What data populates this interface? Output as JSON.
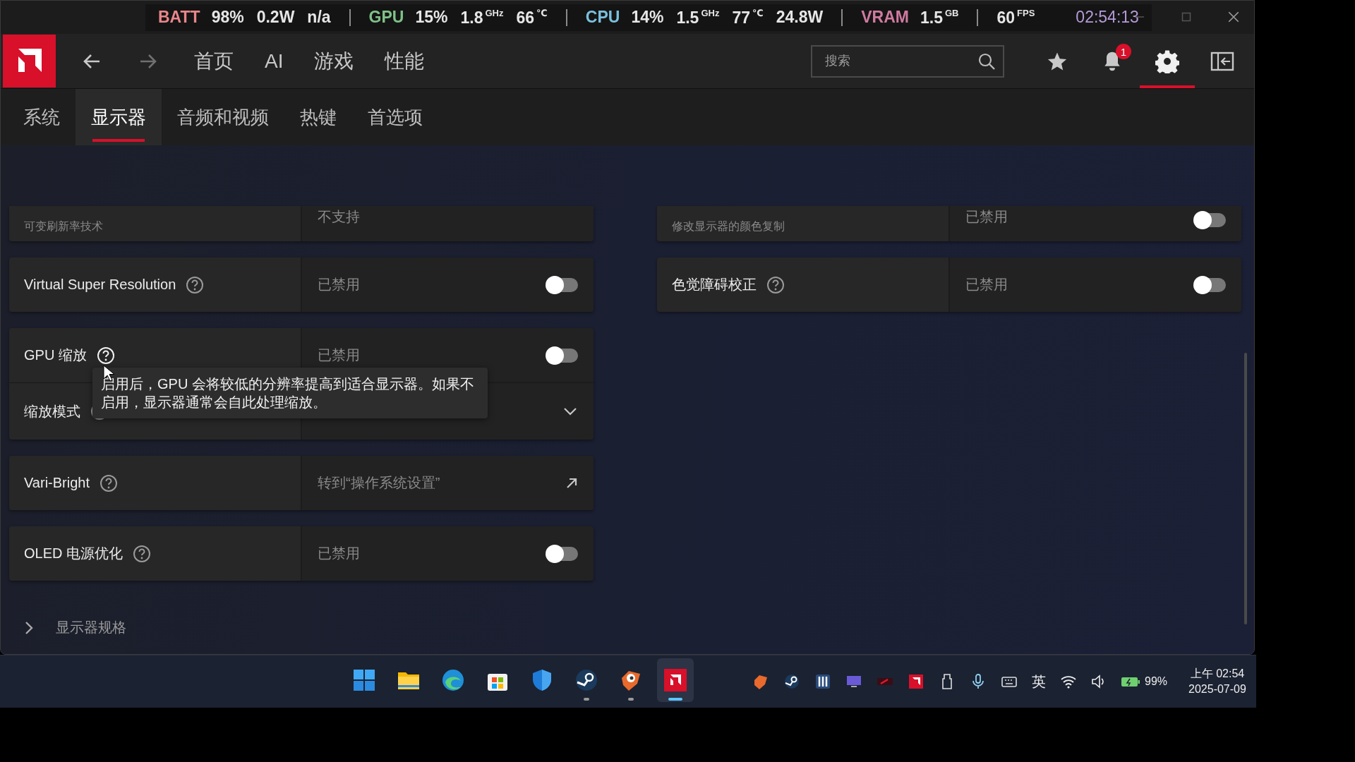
{
  "overlay": {
    "groups": [
      {
        "label": "BATT",
        "color": "#e8868a",
        "readings": [
          {
            "value": "98%"
          },
          {
            "value": "0.2W"
          },
          {
            "value": "n/a"
          }
        ]
      },
      {
        "label": "GPU",
        "color": "#7fc08a",
        "readings": [
          {
            "value": "15%"
          },
          {
            "value": "1.8",
            "unit": "GHz"
          },
          {
            "value": "66",
            "unit": "℃"
          }
        ]
      },
      {
        "label": "CPU",
        "color": "#7ac0dc",
        "readings": [
          {
            "value": "14%"
          },
          {
            "value": "1.5",
            "unit": "GHz"
          },
          {
            "value": "77",
            "unit": "℃"
          },
          {
            "value": "24.8W"
          }
        ]
      },
      {
        "label": "VRAM",
        "color": "#d07aa0",
        "readings": [
          {
            "value": "1.5",
            "unit": "GB"
          }
        ]
      },
      {
        "readings": [
          {
            "value": "60",
            "unit": "FPS"
          }
        ]
      }
    ],
    "time": "02:54:13"
  },
  "nav": [
    {
      "kind": "back",
      "disabled": false
    },
    {
      "kind": "forward",
      "disabled": true
    }
  ],
  "main_tabs": [
    {
      "label": "首页",
      "selected": false
    },
    {
      "label": "AI",
      "selected": false
    },
    {
      "label": "游戏",
      "selected": false
    },
    {
      "label": "性能",
      "selected": false
    }
  ],
  "search": {
    "placeholder": "搜索"
  },
  "toolbar": [
    {
      "kind": "star",
      "selected": false
    },
    {
      "kind": "bell",
      "badge": "1",
      "selected": false
    },
    {
      "kind": "gear",
      "selected": true
    },
    {
      "kind": "panel",
      "selected": false
    }
  ],
  "sub_tabs": [
    {
      "label": "系统",
      "selected": false
    },
    {
      "label": "显示器",
      "selected": true
    },
    {
      "label": "音频和视频",
      "selected": false
    },
    {
      "label": "热键",
      "selected": false
    },
    {
      "label": "首选项",
      "selected": false
    }
  ],
  "left_settings": [
    {
      "kind": "static",
      "subtitle": "可变刷新率技术",
      "value": "不支持"
    },
    {
      "kind": "toggle",
      "title": "Virtual Super Resolution",
      "value": "已禁用",
      "on": false
    },
    {
      "kind": "toggle",
      "title": "GPU 缩放",
      "value": "已禁用",
      "on": false,
      "help_highlighted": true
    },
    {
      "kind": "dropdown",
      "title": "缩放模式"
    },
    {
      "kind": "link",
      "title": "Vari-Bright",
      "value": "转到“操作系统设置”"
    },
    {
      "kind": "toggle",
      "title": "OLED 电源优化",
      "value": "已禁用",
      "on": false
    }
  ],
  "right_settings": [
    {
      "kind": "toggle",
      "subtitle": "修改显示器的颜色复制",
      "value": "已禁用",
      "on": false
    },
    {
      "kind": "toggle",
      "title": "色觉障碍校正",
      "value": "已禁用",
      "on": false
    }
  ],
  "tooltip": "启用后，GPU 会将较低的分辨率提高到适合显示器。如果不启用，显示器通常会自此处理缩放。",
  "expander": {
    "label": "显示器规格",
    "expanded": false
  },
  "taskbar": {
    "apps": [
      {
        "kind": "start",
        "running": false,
        "selected": false
      },
      {
        "kind": "folder",
        "running": false,
        "selected": false
      },
      {
        "kind": "edge",
        "running": false,
        "selected": false
      },
      {
        "kind": "store",
        "running": false,
        "selected": false
      },
      {
        "kind": "shield",
        "running": false,
        "selected": false
      },
      {
        "kind": "steam",
        "running": true,
        "selected": false
      },
      {
        "kind": "bird",
        "running": true,
        "selected": false
      },
      {
        "kind": "amd",
        "running": true,
        "selected": true
      }
    ],
    "tray": [
      {
        "kind": "bird"
      },
      {
        "kind": "steam"
      },
      {
        "kind": "bars"
      },
      {
        "kind": "monitor"
      },
      {
        "kind": "card"
      },
      {
        "kind": "amd"
      },
      {
        "kind": "usb"
      },
      {
        "kind": "mic"
      },
      {
        "kind": "keyboard"
      }
    ],
    "ime": "英",
    "battery": "99%",
    "time": "上午 02:54",
    "date": "2025-07-09"
  }
}
